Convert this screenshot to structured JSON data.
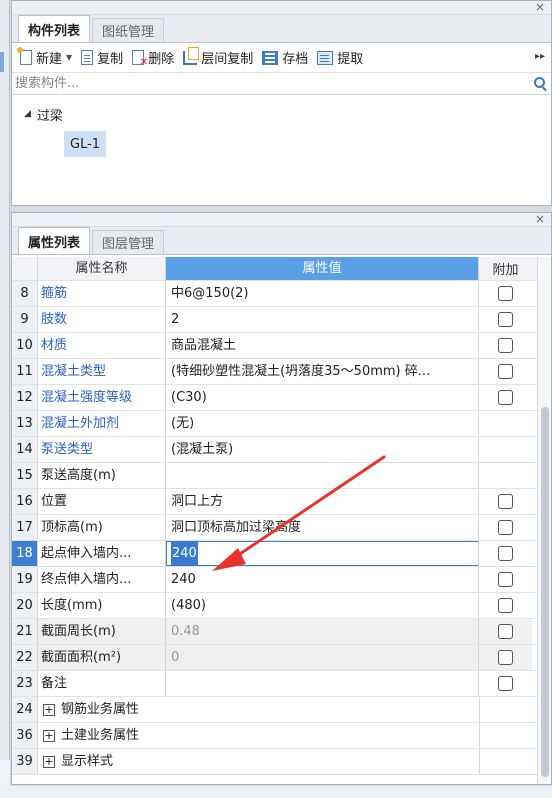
{
  "top_panel": {
    "tabs": [
      {
        "label": "构件列表",
        "active": true
      },
      {
        "label": "图纸管理",
        "active": false
      }
    ],
    "toolbar": {
      "new": "新建",
      "copy": "复制",
      "delete": "删除",
      "layer_copy": "层间复制",
      "save": "存档",
      "fetch": "提取"
    },
    "search_placeholder": "搜索构件...",
    "tree": {
      "root": "过梁",
      "child": "GL-1"
    }
  },
  "bottom_panel": {
    "tabs": [
      {
        "label": "属性列表",
        "active": true
      },
      {
        "label": "图层管理",
        "active": false
      }
    ],
    "headers": {
      "name": "属性名称",
      "value": "属性值",
      "extra": "附加"
    },
    "rows": [
      {
        "num": "8",
        "name": "箍筋",
        "value": "中6@150(2)",
        "blue": true,
        "checkbox": true
      },
      {
        "num": "9",
        "name": "肢数",
        "value": "2",
        "blue": true,
        "checkbox": true
      },
      {
        "num": "10",
        "name": "材质",
        "value": "商品混凝土",
        "blue": true,
        "checkbox": true
      },
      {
        "num": "11",
        "name": "混凝土类型",
        "value": "(特细砂塑性混凝土(坍落度35～50mm) 碎...",
        "blue": true,
        "checkbox": true
      },
      {
        "num": "12",
        "name": "混凝土强度等级",
        "value": "(C30)",
        "blue": true,
        "checkbox": true
      },
      {
        "num": "13",
        "name": "混凝土外加剂",
        "value": "(无)",
        "blue": true,
        "checkbox": false
      },
      {
        "num": "14",
        "name": "泵送类型",
        "value": "(混凝土泵)",
        "blue": true,
        "checkbox": false
      },
      {
        "num": "15",
        "name": "泵送高度(m)",
        "value": "",
        "blue": false,
        "checkbox": false
      },
      {
        "num": "16",
        "name": "位置",
        "value": "洞口上方",
        "blue": false,
        "checkbox": true
      },
      {
        "num": "17",
        "name": "顶标高(m)",
        "value": "洞口顶标高加过梁高度",
        "blue": false,
        "checkbox": true
      },
      {
        "num": "18",
        "name": "起点伸入墙内...",
        "value": "240",
        "blue": false,
        "checkbox": true,
        "selected": true
      },
      {
        "num": "19",
        "name": "终点伸入墙内...",
        "value": "240",
        "blue": false,
        "checkbox": true
      },
      {
        "num": "20",
        "name": "长度(mm)",
        "value": "(480)",
        "blue": false,
        "checkbox": true
      },
      {
        "num": "21",
        "name": "截面周长(m)",
        "value": "0.48",
        "blue": false,
        "checkbox": true,
        "readonly": true
      },
      {
        "num": "22",
        "name": "截面面积(m²)",
        "value": "0",
        "blue": false,
        "checkbox": true,
        "readonly": true
      },
      {
        "num": "23",
        "name": "备注",
        "value": "",
        "blue": false,
        "checkbox": true
      },
      {
        "num": "24",
        "name": "钢筋业务属性",
        "value": "",
        "group": true
      },
      {
        "num": "36",
        "name": "土建业务属性",
        "value": "",
        "group": true
      },
      {
        "num": "39",
        "name": "显示样式",
        "value": "",
        "group": true
      }
    ]
  },
  "colors": {
    "accent": "#3d7fd0",
    "header_blue": "#5ba0e6",
    "link_blue": "#2b63c7",
    "arrow": "#e8332a"
  }
}
